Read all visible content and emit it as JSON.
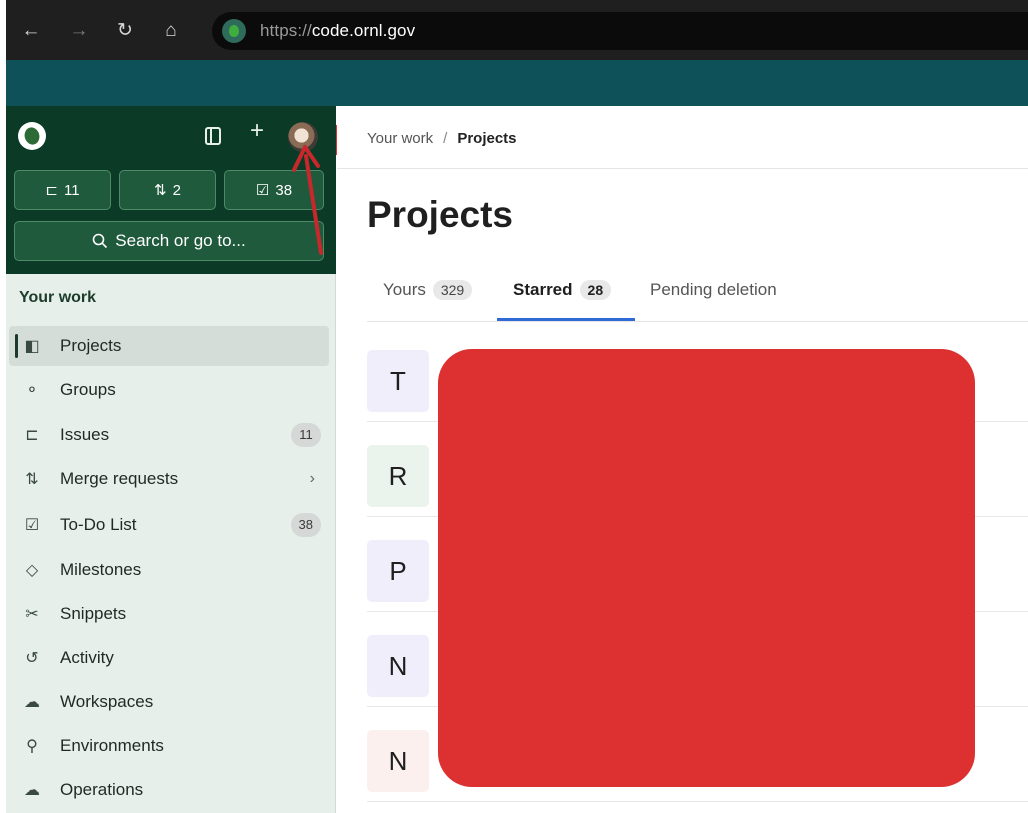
{
  "browser": {
    "back_glyph": "←",
    "forward_glyph": "→",
    "reload_glyph": "↻",
    "home_glyph": "⌂",
    "url_scheme": "https://",
    "url_host": "code.ornl.gov"
  },
  "sidebar": {
    "counters": [
      {
        "icon": "issues-icon",
        "glyph": "⊏",
        "count": "11"
      },
      {
        "icon": "merge-request-icon",
        "glyph": "⇅",
        "count": "2"
      },
      {
        "icon": "todo-icon",
        "glyph": "☑",
        "count": "38"
      }
    ],
    "search_label": "Search or go to...",
    "section_title": "Your work",
    "items": [
      {
        "label": "Projects",
        "glyph": "◧",
        "active": true
      },
      {
        "label": "Groups",
        "glyph": "⚬",
        "active": false
      },
      {
        "label": "Issues",
        "glyph": "⊏",
        "badge": "11",
        "active": false
      },
      {
        "label": "Merge requests",
        "glyph": "⇅",
        "chevron": "›",
        "active": false
      },
      {
        "label": "To-Do List",
        "glyph": "☑",
        "badge": "38",
        "active": false
      },
      {
        "label": "Milestones",
        "glyph": "◇",
        "active": false
      },
      {
        "label": "Snippets",
        "glyph": "✂",
        "active": false
      },
      {
        "label": "Activity",
        "glyph": "↺",
        "active": false
      },
      {
        "label": "Workspaces",
        "glyph": "☁",
        "active": false
      },
      {
        "label": "Environments",
        "glyph": "⚲",
        "active": false
      },
      {
        "label": "Operations",
        "glyph": "☁",
        "active": false
      }
    ]
  },
  "main": {
    "breadcrumb": {
      "parent": "Your work",
      "separator": "/",
      "current": "Projects"
    },
    "title": "Projects",
    "tabs": [
      {
        "label": "Yours",
        "count": "329",
        "active": false
      },
      {
        "label": "Starred",
        "count": "28",
        "active": true
      },
      {
        "label": "Pending deletion",
        "active": false
      }
    ],
    "projects": [
      {
        "initial": "T",
        "color": "#f0eefb"
      },
      {
        "initial": "R",
        "color": "#eaf3ec"
      },
      {
        "initial": "P",
        "color": "#f0eefb"
      },
      {
        "initial": "N",
        "color": "#f0eefb"
      },
      {
        "initial": "N",
        "color": "#fbf0ee"
      }
    ]
  },
  "colors": {
    "sidebar_dark": "#0b3b26",
    "sidebar_light": "#e6efe9",
    "tab_accent": "#2f6ad6",
    "redaction": "#dd3030",
    "annotation_arrow": "#c8282b"
  }
}
